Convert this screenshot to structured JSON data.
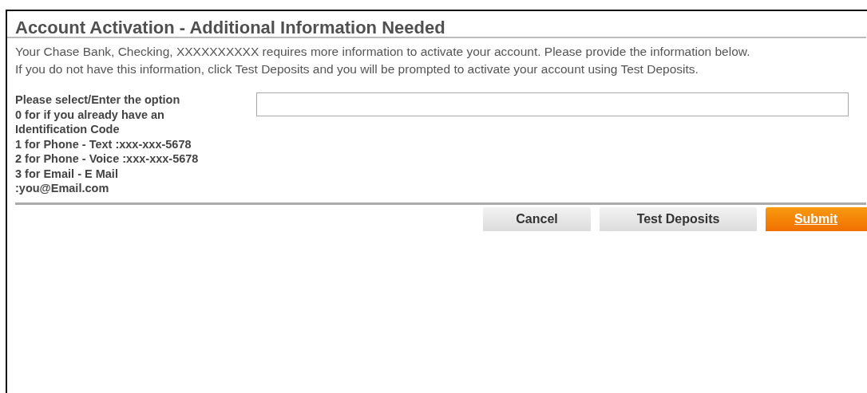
{
  "dialog": {
    "title": "Account Activation - Additional Information Needed",
    "paragraphs": [
      "Your Chase Bank, Checking, XXXXXXXXXX requires more information to activate your account. Please provide the information below.",
      "If you do not have this information, click Test Deposits and you will be prompted to activate your account using Test Deposits."
    ],
    "field": {
      "label_lines": [
        "Please select/Enter the option",
        "0 for if you already have an Identification Code",
        "1 for Phone - Text :xxx-xxx-5678",
        "2 for Phone - Voice :xxx-xxx-5678",
        "3 for Email - E Mail :you@Email.com"
      ]
    },
    "buttons": [
      {
        "label": "Cancel",
        "kind": "secondary"
      },
      {
        "label": "Test Deposits",
        "kind": "secondary"
      },
      {
        "label": "Submit",
        "kind": "primary"
      }
    ]
  }
}
